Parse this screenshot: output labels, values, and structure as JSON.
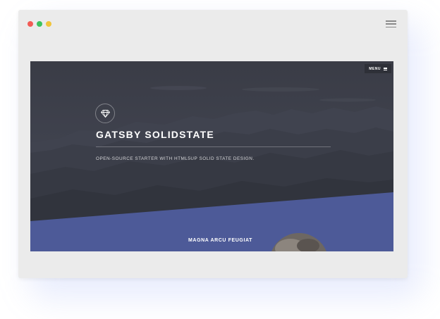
{
  "window": {
    "controls": [
      "close",
      "minimize",
      "maximize"
    ],
    "menu_icon": "hamburger-icon"
  },
  "site": {
    "menu_label": "MENU",
    "logo_icon": "diamond-icon",
    "title": "GATSBY SOLIDSTATE",
    "tagline": "OPEN-SOURCE STARTER WITH HTML5UP SOLID STATE DESIGN."
  },
  "section": {
    "title": "MAGNA ARCU FEUGIAT"
  },
  "colors": {
    "hero_bg": "#3c3e48",
    "section_bg": "#4d5a98",
    "window_bg": "#ebebeb"
  }
}
